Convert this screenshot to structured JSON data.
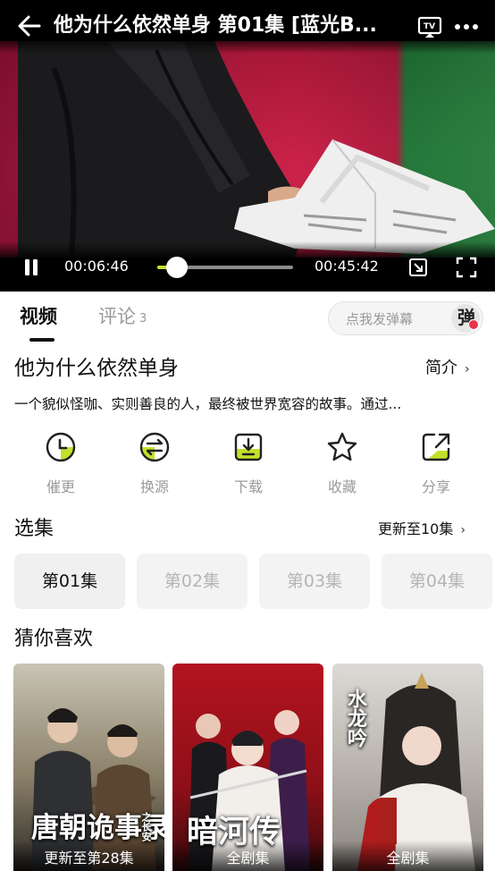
{
  "player": {
    "title": "他为什么依然单身 第01集 [蓝光B...",
    "current_time": "00:06:46",
    "duration": "00:45:42",
    "progress": 0.148,
    "icons": [
      "back-arrow-icon",
      "tv-cast-icon",
      "more-icon",
      "pause-icon",
      "pip-icon",
      "fullscreen-icon"
    ]
  },
  "tabs": {
    "video": "视频",
    "comments": "评论",
    "comment_count": "3"
  },
  "danmu": {
    "placeholder": "点我发弹幕",
    "toggle_glyph": "弹"
  },
  "show": {
    "title": "他为什么依然单身",
    "intro_label": "简介",
    "description": "一个貌似怪咖、实则善良的人，最终被世界宽容的故事。通过..."
  },
  "actions": [
    {
      "label": "催更",
      "icon": "clock-icon"
    },
    {
      "label": "换源",
      "icon": "switch-source-icon"
    },
    {
      "label": "下载",
      "icon": "download-icon"
    },
    {
      "label": "收藏",
      "icon": "star-icon"
    },
    {
      "label": "分享",
      "icon": "share-icon"
    }
  ],
  "episodes": {
    "header": "选集",
    "update_label": "更新至10集",
    "items": [
      "第01集",
      "第02集",
      "第03集",
      "第04集"
    ],
    "selected": "第01集"
  },
  "recommend": {
    "header": "猜你喜欢",
    "items": [
      {
        "badge": "更新至第28集",
        "poster_text": "唐朝诡事录",
        "poster_sub": "之长安"
      },
      {
        "badge": "全剧集",
        "poster_text": "暗河传"
      },
      {
        "badge": "全剧集",
        "poster_text": "水龙吟"
      }
    ]
  },
  "colors": {
    "accent": "#c3e02b",
    "danmu_dot": "#e8334a",
    "muted_text": "#9a9a9a"
  }
}
